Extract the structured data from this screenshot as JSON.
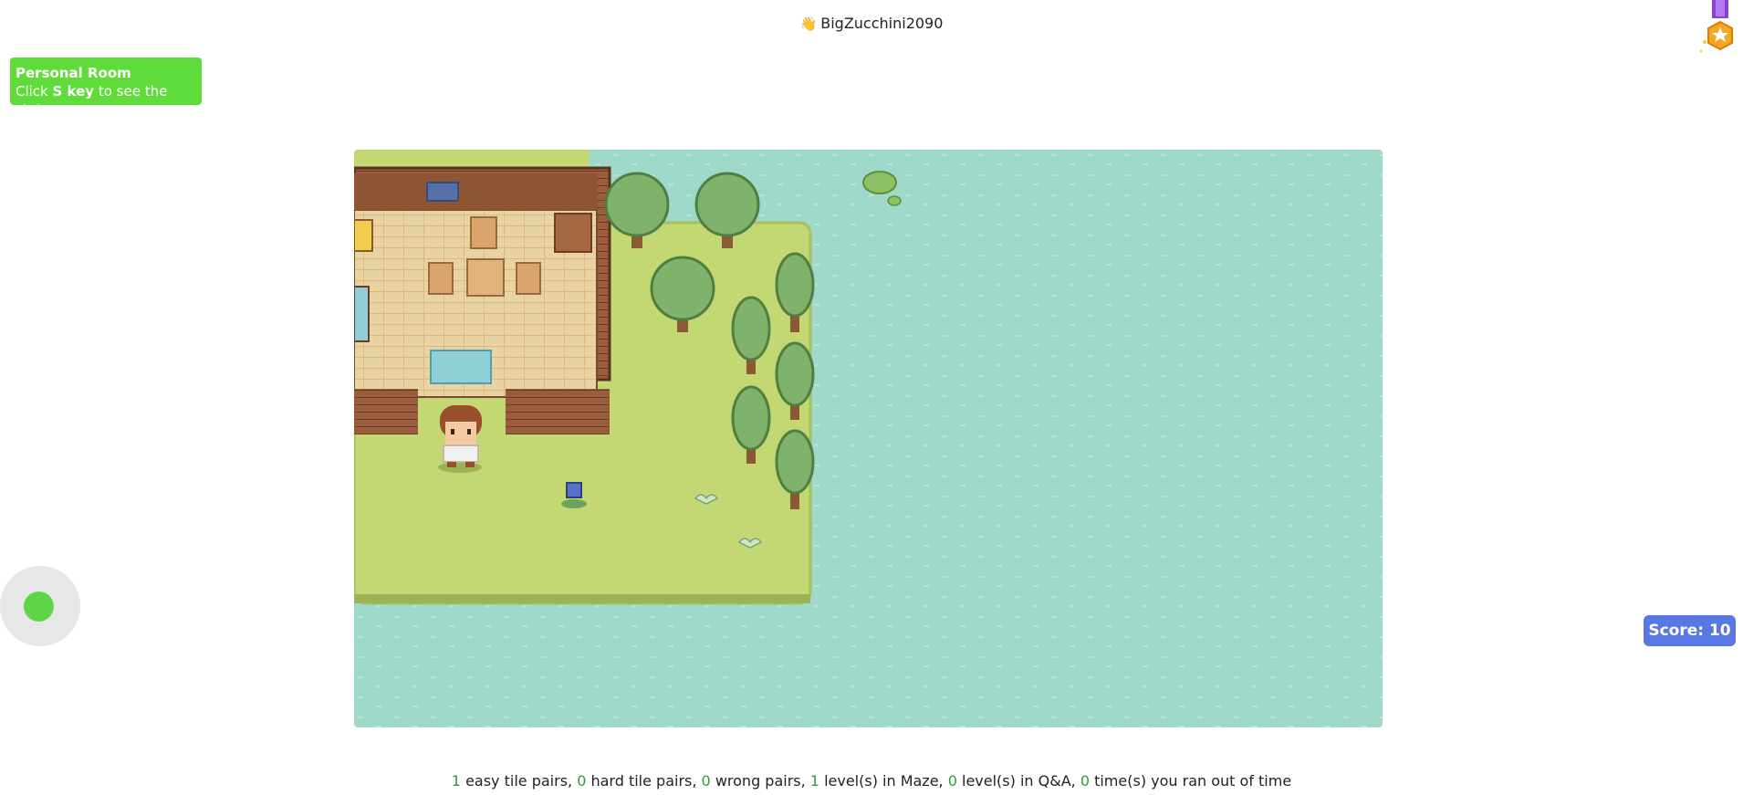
{
  "header": {
    "wave_icon": "waving-hand-icon",
    "username": "BigZucchini2090"
  },
  "room_badge": {
    "line1": "Personal Room",
    "line2_prefix": "Click ",
    "line2_key": "S key",
    "line2_suffix": " to see the stats"
  },
  "medal": {
    "icon": "medal-star-icon",
    "ribbon_color": "#8b3fd9",
    "badge_color": "#f5a623"
  },
  "joystick": {
    "icon": "joystick-knob",
    "knob_color": "#5fd649"
  },
  "score": {
    "label": "Score: 10"
  },
  "game": {
    "water_color": "#9fd9c9",
    "grass_color": "#c3d872",
    "character": "brown-haired-player"
  },
  "stats": {
    "easy_count": "1",
    "easy_label": " easy tile pairs, ",
    "hard_count": "0",
    "hard_label": " hard tile pairs, ",
    "wrong_count": "0",
    "wrong_label": " wrong pairs, ",
    "maze_count": "1",
    "maze_label": " level(s) in Maze, ",
    "qa_count": "0",
    "qa_label": " level(s) in Q&A, ",
    "timeout_count": "0",
    "timeout_label": " time(s) you ran out of time"
  }
}
